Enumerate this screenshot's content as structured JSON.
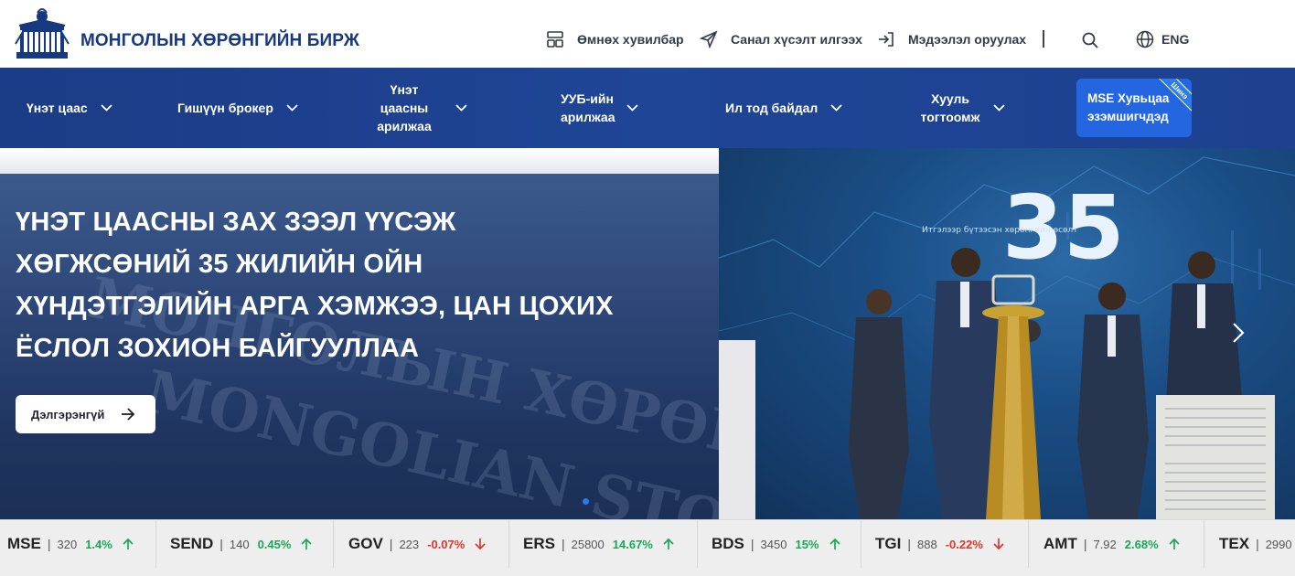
{
  "header": {
    "brand_name": "МОНГОЛЫН ХӨРӨНГИЙН БИРЖ",
    "links": [
      {
        "label": "Өмнөх хувилбар",
        "icon": "layout-icon"
      },
      {
        "label": "Санал хүсэлт илгээх",
        "icon": "send-icon"
      },
      {
        "label": "Мэдээлэл оруулах",
        "icon": "login-icon"
      }
    ],
    "language_label": "ENG"
  },
  "nav": {
    "items": [
      {
        "label": "Үнэт цаас"
      },
      {
        "label": "Гишүүн брокер"
      },
      {
        "label": "Үнэт цаасны арилжаа"
      },
      {
        "label": "УУБ-ийн арилжаа"
      },
      {
        "label": "Ил тод байдал"
      },
      {
        "label": "Хууль тогтоомж"
      }
    ],
    "cta_label": "MSE Хувьцаа эзэмшигчдэд",
    "cta_badge": "Шинэ"
  },
  "hero": {
    "headline_lines": [
      "ҮНЭТ ЦААСНЫ ЗАХ ЗЭЭЛ ҮҮСЭЖ",
      "ХӨГЖСӨНИЙ 35 ЖИЛИЙН ОЙН",
      "ХҮНДЭТГЭЛИЙН АРГА ХЭМЖЭЭ, ЦАН ЦОХИХ",
      "ЁСЛОЛ ЗОХИОН БАЙГУУЛЛАА"
    ],
    "more_label": "Дэлгэрэнгүй",
    "watermark_lines": [
      "МОНГОЛЫН ХӨРӨНГ",
      "MONGOLIAN STOCK"
    ],
    "photo_text_35": "35",
    "photo_caption": "Итгэлээр бүтээсэн хөрөнгийн өсөлт"
  },
  "ticker": [
    {
      "symbol": "MSE",
      "price": "320",
      "change": "1.4%",
      "direction": "up"
    },
    {
      "symbol": "SEND",
      "price": "140",
      "change": "0.45%",
      "direction": "up"
    },
    {
      "symbol": "GOV",
      "price": "223",
      "change": "-0.07%",
      "direction": "down"
    },
    {
      "symbol": "ERS",
      "price": "25800",
      "change": "14.67%",
      "direction": "up"
    },
    {
      "symbol": "BDS",
      "price": "3450",
      "change": "15%",
      "direction": "up"
    },
    {
      "symbol": "TGI",
      "price": "888",
      "change": "-0.22%",
      "direction": "down"
    },
    {
      "symbol": "AMT",
      "price": "7.92",
      "change": "2.68%",
      "direction": "up"
    },
    {
      "symbol": "TEX",
      "price": "2990",
      "change": "",
      "direction": ""
    }
  ],
  "colors": {
    "brand": "#17397f",
    "nav": "#1f4597",
    "cta": "#2466e0",
    "up": "#1aa75a",
    "down": "#e0352b"
  }
}
